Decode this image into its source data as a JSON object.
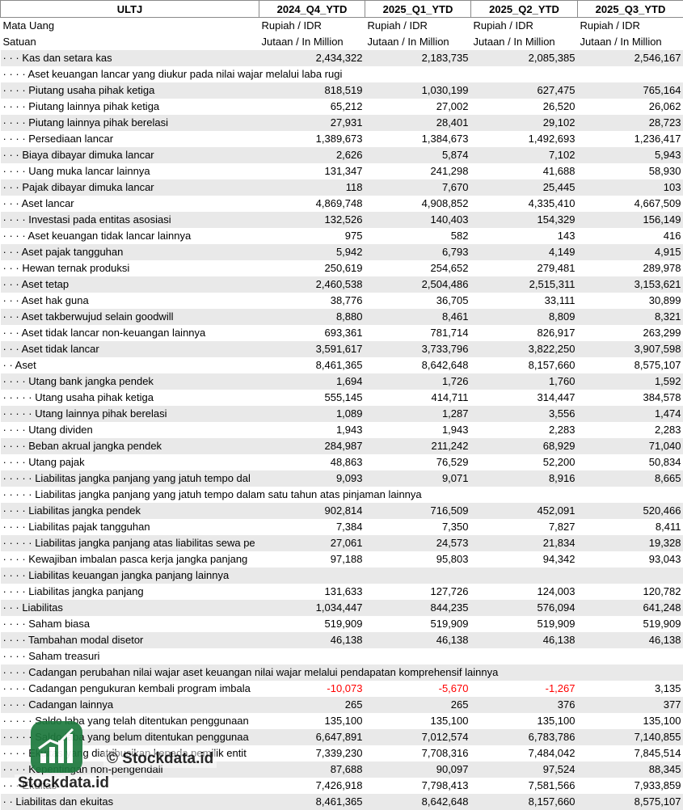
{
  "header": {
    "ticker": "ULTJ",
    "periods": [
      "2024_Q4_YTD",
      "2025_Q1_YTD",
      "2025_Q2_YTD",
      "2025_Q3_YTD"
    ]
  },
  "meta_rows": [
    {
      "label": "Mata Uang",
      "values": [
        "Rupiah / IDR",
        "Rupiah / IDR",
        "Rupiah / IDR",
        "Rupiah / IDR"
      ]
    },
    {
      "label": "Satuan",
      "values": [
        "Jutaan / In Million",
        "Jutaan / In Million",
        "Jutaan / In Million",
        "Jutaan / In Million"
      ]
    }
  ],
  "rows": [
    {
      "label": "· · · Kas dan setara kas",
      "values": [
        "2,434,322",
        "2,183,735",
        "2,085,385",
        "2,546,167"
      ]
    },
    {
      "label": "· · · · Aset keuangan lancar yang diukur pada nilai wajar melalui laba rugi",
      "values": [
        "",
        "",
        "",
        ""
      ]
    },
    {
      "label": "· · · · Piutang usaha pihak ketiga",
      "values": [
        "818,519",
        "1,030,199",
        "627,475",
        "765,164"
      ]
    },
    {
      "label": "· · · · Piutang lainnya pihak ketiga",
      "values": [
        "65,212",
        "27,002",
        "26,520",
        "26,062"
      ]
    },
    {
      "label": "· · · · Piutang lainnya pihak berelasi",
      "values": [
        "27,931",
        "28,401",
        "29,102",
        "28,723"
      ]
    },
    {
      "label": "· · · · Persediaan lancar",
      "values": [
        "1,389,673",
        "1,384,673",
        "1,492,693",
        "1,236,417"
      ]
    },
    {
      "label": "· · · Biaya dibayar dimuka lancar",
      "values": [
        "2,626",
        "5,874",
        "7,102",
        "5,943"
      ]
    },
    {
      "label": "· · · · Uang muka lancar lainnya",
      "values": [
        "131,347",
        "241,298",
        "41,688",
        "58,930"
      ]
    },
    {
      "label": "· · · Pajak dibayar dimuka lancar",
      "values": [
        "118",
        "7,670",
        "25,445",
        "103"
      ]
    },
    {
      "label": "· · · Aset lancar",
      "values": [
        "4,869,748",
        "4,908,852",
        "4,335,410",
        "4,667,509"
      ]
    },
    {
      "label": "· · · · Investasi pada entitas asosiasi",
      "values": [
        "132,526",
        "140,403",
        "154,329",
        "156,149"
      ]
    },
    {
      "label": "· · · · Aset keuangan tidak lancar lainnya",
      "values": [
        "975",
        "582",
        "143",
        "416"
      ]
    },
    {
      "label": "· · · Aset pajak tangguhan",
      "values": [
        "5,942",
        "6,793",
        "4,149",
        "4,915"
      ]
    },
    {
      "label": "· · · Hewan ternak produksi",
      "values": [
        "250,619",
        "254,652",
        "279,481",
        "289,978"
      ]
    },
    {
      "label": "· · · Aset tetap",
      "values": [
        "2,460,538",
        "2,504,486",
        "2,515,311",
        "3,153,621"
      ]
    },
    {
      "label": "· · · Aset hak guna",
      "values": [
        "38,776",
        "36,705",
        "33,111",
        "30,899"
      ]
    },
    {
      "label": "· · · Aset takberwujud selain goodwill",
      "values": [
        "8,880",
        "8,461",
        "8,809",
        "8,321"
      ]
    },
    {
      "label": "· · · Aset tidak lancar non-keuangan lainnya",
      "values": [
        "693,361",
        "781,714",
        "826,917",
        "263,299"
      ]
    },
    {
      "label": "· · · Aset tidak lancar",
      "values": [
        "3,591,617",
        "3,733,796",
        "3,822,250",
        "3,907,598"
      ]
    },
    {
      "label": "· · Aset",
      "values": [
        "8,461,365",
        "8,642,648",
        "8,157,660",
        "8,575,107"
      ]
    },
    {
      "label": "· · · · Utang bank jangka pendek",
      "values": [
        "1,694",
        "1,726",
        "1,760",
        "1,592"
      ]
    },
    {
      "label": "· · · · · Utang usaha pihak ketiga",
      "values": [
        "555,145",
        "414,711",
        "314,447",
        "384,578"
      ]
    },
    {
      "label": "· · · · · Utang lainnya pihak berelasi",
      "values": [
        "1,089",
        "1,287",
        "3,556",
        "1,474"
      ]
    },
    {
      "label": "· · · · Utang dividen",
      "values": [
        "1,943",
        "1,943",
        "2,283",
        "2,283"
      ]
    },
    {
      "label": "· · · · Beban akrual jangka pendek",
      "values": [
        "284,987",
        "211,242",
        "68,929",
        "71,040"
      ]
    },
    {
      "label": "· · · · Utang pajak",
      "values": [
        "48,863",
        "76,529",
        "52,200",
        "50,834"
      ]
    },
    {
      "label": "· · · · · Liabilitas jangka panjang yang jatuh tempo dal",
      "values": [
        "9,093",
        "9,071",
        "8,916",
        "8,665"
      ]
    },
    {
      "label": "· · · · · Liabilitas jangka panjang yang jatuh tempo dalam satu tahun atas pinjaman lainnya",
      "values": [
        "",
        "",
        "",
        ""
      ]
    },
    {
      "label": "· · · · Liabilitas jangka pendek",
      "values": [
        "902,814",
        "716,509",
        "452,091",
        "520,466"
      ]
    },
    {
      "label": "· · · · Liabilitas pajak tangguhan",
      "values": [
        "7,384",
        "7,350",
        "7,827",
        "8,411"
      ]
    },
    {
      "label": "· · · · · Liabilitas jangka panjang atas liabilitas sewa pe",
      "values": [
        "27,061",
        "24,573",
        "21,834",
        "19,328"
      ]
    },
    {
      "label": "· · · · Kewajiban imbalan pasca kerja jangka panjang",
      "values": [
        "97,188",
        "95,803",
        "94,342",
        "93,043"
      ]
    },
    {
      "label": "· · · · Liabilitas keuangan jangka panjang lainnya",
      "values": [
        "",
        "",
        "",
        ""
      ]
    },
    {
      "label": "· · · · Liabilitas jangka panjang",
      "values": [
        "131,633",
        "127,726",
        "124,003",
        "120,782"
      ]
    },
    {
      "label": "· · · Liabilitas",
      "values": [
        "1,034,447",
        "844,235",
        "576,094",
        "641,248"
      ]
    },
    {
      "label": "· · · · Saham biasa",
      "values": [
        "519,909",
        "519,909",
        "519,909",
        "519,909"
      ]
    },
    {
      "label": "· · · · Tambahan modal disetor",
      "values": [
        "46,138",
        "46,138",
        "46,138",
        "46,138"
      ]
    },
    {
      "label": "· · · · Saham treasuri",
      "values": [
        "",
        "",
        "",
        ""
      ]
    },
    {
      "label": "· · · · Cadangan perubahan nilai wajar aset keuangan nilai wajar melalui pendapatan komprehensif lainnya",
      "values": [
        "",
        "",
        "",
        ""
      ]
    },
    {
      "label": "· · · · Cadangan pengukuran kembali program imbala",
      "values": [
        "-10,073",
        "-5,670",
        "-1,267",
        "3,135"
      ]
    },
    {
      "label": "· · · · Cadangan lainnya",
      "values": [
        "265",
        "265",
        "376",
        "377"
      ]
    },
    {
      "label": "· · · · · Saldo laba yang telah ditentukan penggunaan",
      "values": [
        "135,100",
        "135,100",
        "135,100",
        "135,100"
      ]
    },
    {
      "label": "· · · · · Saldo laba yang belum ditentukan penggunaa",
      "values": [
        "6,647,891",
        "7,012,574",
        "6,783,786",
        "7,140,855"
      ]
    },
    {
      "label": "· · · · Ekuitas yang diatribusikan kepada pemilik entit",
      "values": [
        "7,339,230",
        "7,708,316",
        "7,484,042",
        "7,845,514"
      ]
    },
    {
      "label": "· · · · Kepentingan non-pengendali",
      "values": [
        "87,688",
        "90,097",
        "97,524",
        "88,345"
      ]
    },
    {
      "label": "· · · Ekuitas",
      "values": [
        "7,426,918",
        "7,798,413",
        "7,581,566",
        "7,933,859"
      ]
    },
    {
      "label": "· · Liabilitas dan ekuitas",
      "values": [
        "8,461,365",
        "8,642,648",
        "8,157,660",
        "8,575,107"
      ]
    }
  ],
  "watermark": {
    "copyright": "© Stockdata.id",
    "brand": "Stockdata.id",
    "icon": "stockdata-logo-icon"
  }
}
